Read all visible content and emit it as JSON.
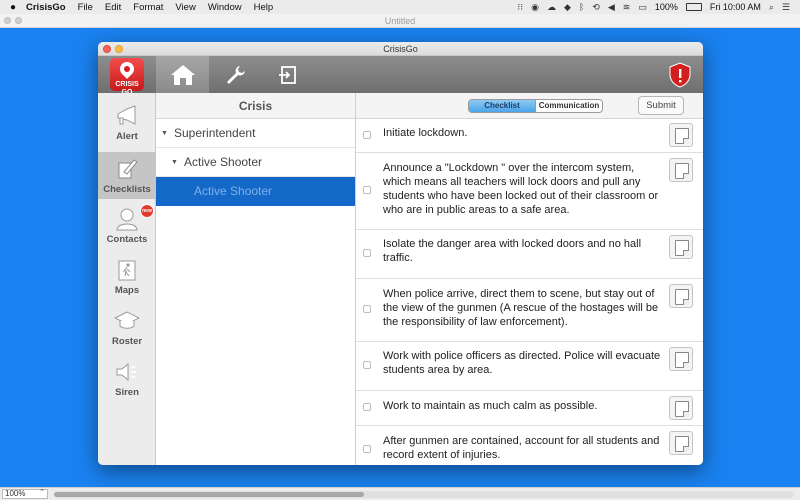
{
  "menubar": {
    "apple_icon": "apple-icon",
    "app_name": "CrisisGo",
    "menus": [
      "File",
      "Edit",
      "Format",
      "View",
      "Window",
      "Help"
    ],
    "battery": "100%",
    "clock": "Fri 10:00 AM"
  },
  "host_window": {
    "title": "Untitled",
    "zoom": "100%"
  },
  "app": {
    "window_title": "CrisisGo",
    "logo_text": "CRISIS GO",
    "toolbar_icons": [
      "home-icon",
      "wrench-icon",
      "logout-icon",
      "shield-alert-icon"
    ]
  },
  "nav": {
    "items": [
      {
        "label": "Alert",
        "icon": "megaphone-icon"
      },
      {
        "label": "Checklists",
        "icon": "checklist-icon"
      },
      {
        "label": "Contacts",
        "icon": "person-icon"
      },
      {
        "label": "Maps",
        "icon": "exit-map-icon"
      },
      {
        "label": "Roster",
        "icon": "graduation-cap-icon"
      },
      {
        "label": "Siren",
        "icon": "speaker-icon"
      }
    ],
    "contacts_badge": "new"
  },
  "tree": {
    "header": "Crisis",
    "items": [
      {
        "label": "Superintendent"
      },
      {
        "label": "Active Shooter"
      },
      {
        "label": "Active Shooter"
      }
    ]
  },
  "checklist": {
    "tabs": [
      "Checklist",
      "Communication"
    ],
    "active_tab": "Checklist",
    "submit_label": "Submit",
    "rows": [
      {
        "text": "Initiate lockdown."
      },
      {
        "text": "Announce a \"Lockdown \" over the intercom system, which means all teachers will lock doors and pull any students who have been locked out of their classroom or who are in public areas to a safe area."
      },
      {
        "text": "Isolate the danger area with locked doors and no hall traffic."
      },
      {
        "text": "When police arrive, direct them to scene, but stay out of the view of the gunmen (A rescue of the hostages will be the responsibility of law enforcement)."
      },
      {
        "text": "Work with police officers as directed. Police will evacuate students area by area."
      },
      {
        "text": "Work to maintain as much calm as possible."
      },
      {
        "text": "After gunmen are contained, account for all students and record extent of injuries."
      }
    ]
  },
  "colors": {
    "desktop": "#1a82f0",
    "selection": "#1468c8",
    "alert_red": "#d21f1f",
    "segment_active": "#4ba4e8"
  }
}
